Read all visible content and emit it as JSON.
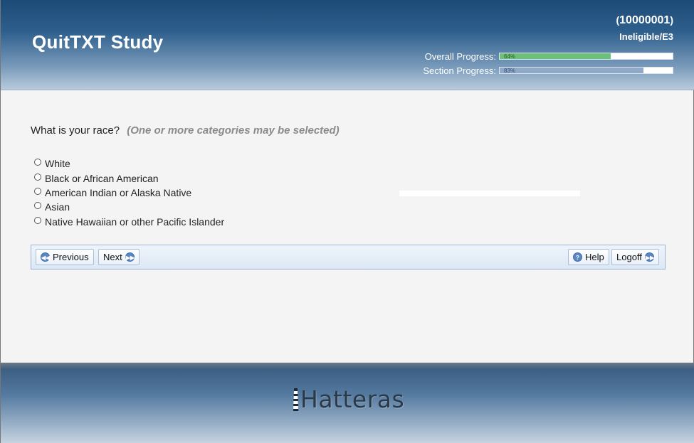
{
  "header": {
    "app_title": "QuitTXT Study",
    "participant_id": "10000001",
    "status": "Ineligible/E3",
    "overall_progress": {
      "label": "Overall Progress:",
      "percent_text": "64%",
      "value": 64
    },
    "section_progress": {
      "label": "Section Progress:",
      "percent_text": "83%",
      "value": 83
    }
  },
  "question": {
    "text": "What is your race?",
    "hint": "(One or more categories may be selected)",
    "options": [
      {
        "label": "White"
      },
      {
        "label": "Black or African American"
      },
      {
        "label": "American Indian or Alaska Native"
      },
      {
        "label": "Asian"
      },
      {
        "label": "Native Hawaiian or other Pacific Islander"
      }
    ]
  },
  "nav": {
    "previous_label": "Previous",
    "next_label": "Next",
    "help_label": "Help",
    "logoff_label": "Logoff"
  },
  "footer": {
    "logo_text": "Hatteras"
  },
  "colors": {
    "header_dark": "#1d4a76",
    "progress_overall": "#6cc17a",
    "progress_section": "#8fa9c6",
    "nav_button_icon": "#5b86c4"
  },
  "icons": {
    "previous": "rewind-icon",
    "next": "fast-forward-icon",
    "help": "question-circle-icon",
    "logoff": "fast-forward-icon"
  }
}
